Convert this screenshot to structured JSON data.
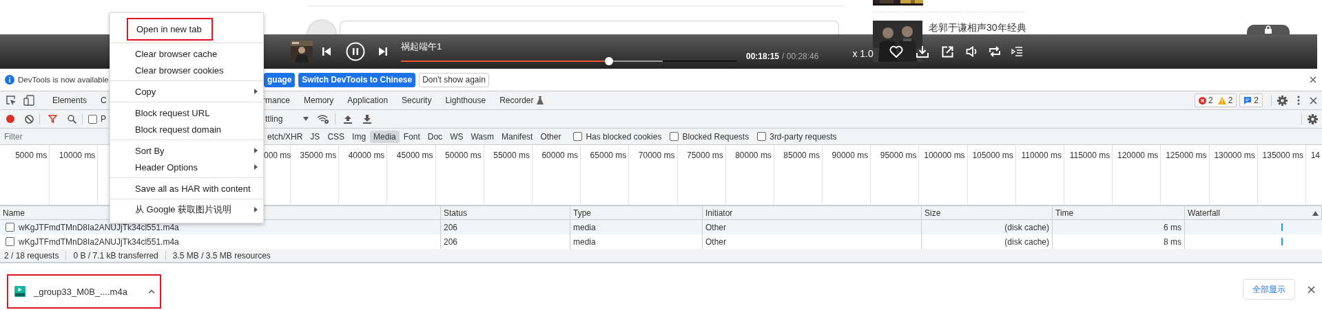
{
  "page": {
    "sidebar_title": "老郭于谦相声30年经典"
  },
  "player": {
    "title": "祸起端午1",
    "elapsed": "00:18:15",
    "total": "/ 00:28:46",
    "speed": "x 1.0",
    "playing": true,
    "progress": {
      "level": 0.62
    },
    "buffer": {
      "level": 0.78
    }
  },
  "infobar": {
    "message": "DevTools is now available",
    "buttons": [
      {
        "label": "guage",
        "kind": "primary"
      },
      {
        "label": "Switch DevTools to Chinese",
        "kind": "primary"
      },
      {
        "label": "Don't show again",
        "kind": "plain"
      }
    ]
  },
  "tabs": {
    "before_menu": [
      {
        "label": "Elements",
        "selected": false
      },
      {
        "label": "C",
        "selected": false
      }
    ],
    "after_menu": [
      {
        "label": "rmance",
        "selected": false
      },
      {
        "label": "Memory",
        "selected": false
      },
      {
        "label": "Application",
        "selected": false
      },
      {
        "label": "Security",
        "selected": false
      },
      {
        "label": "Lighthouse",
        "selected": false
      },
      {
        "label": "Recorder",
        "selected": false
      }
    ]
  },
  "issues": {
    "errors": "2",
    "warnings": "2",
    "messages": "2"
  },
  "toolbar": {
    "recording": true,
    "preserve_label": "P",
    "preserve_checked": false,
    "throttling": "ttling"
  },
  "filter": {
    "placeholder": "Filter",
    "types": [
      {
        "label": "etch/XHR",
        "selected": false
      },
      {
        "label": "JS",
        "selected": false
      },
      {
        "label": "CSS",
        "selected": false
      },
      {
        "label": "Img",
        "selected": false
      },
      {
        "label": "Media",
        "selected": true
      },
      {
        "label": "Font",
        "selected": false
      },
      {
        "label": "Doc",
        "selected": false
      },
      {
        "label": "WS",
        "selected": false
      },
      {
        "label": "Wasm",
        "selected": false
      },
      {
        "label": "Manifest",
        "selected": false
      },
      {
        "label": "Other",
        "selected": false
      }
    ],
    "checkboxes": [
      {
        "label": "Has blocked cookies",
        "checked": false
      },
      {
        "label": "Blocked Requests",
        "checked": false
      },
      {
        "label": "3rd-party requests",
        "checked": false
      }
    ]
  },
  "timeline": {
    "before_menu": [
      "5000 ms",
      "10000 ms"
    ],
    "after_menu": [
      "000 ms",
      "35000 ms",
      "40000 ms",
      "45000 ms",
      "50000 ms",
      "55000 ms",
      "60000 ms",
      "65000 ms",
      "70000 ms",
      "75000 ms",
      "80000 ms",
      "85000 ms",
      "90000 ms",
      "95000 ms",
      "100000 ms",
      "105000 ms",
      "110000 ms",
      "115000 ms",
      "120000 ms",
      "125000 ms",
      "130000 ms",
      "135000 ms",
      "14"
    ]
  },
  "table": {
    "columns": [
      {
        "label": "Name",
        "sorted": false
      },
      {
        "label": "Status",
        "sorted": false
      },
      {
        "label": "Type",
        "sorted": false
      },
      {
        "label": "Initiator",
        "sorted": false
      },
      {
        "label": "Size",
        "sorted": false
      },
      {
        "label": "Time",
        "sorted": false
      },
      {
        "label": "Waterfall",
        "sorted": true
      }
    ],
    "rows": [
      {
        "checked": false,
        "cells": [
          "wKgJTFmdTMnD8Ia2ANUJjTk34cl551.m4a",
          "206",
          "media",
          "Other",
          "(disk cache)",
          "6 ms"
        ]
      },
      {
        "checked": false,
        "cells": [
          "wKgJTFmdTMnD8Ia2ANUJjTk34cl551.m4a",
          "206",
          "media",
          "Other",
          "(disk cache)",
          "8 ms"
        ]
      }
    ]
  },
  "status_bar": [
    "2 / 18 requests",
    "0 B / 7.1 kB transferred",
    "3.5 MB / 3.5 MB resources"
  ],
  "context_menu": [
    [
      {
        "label": "Open in new tab",
        "submenu": false,
        "highlighted": true
      }
    ],
    [
      {
        "label": "Clear browser cache",
        "submenu": false,
        "highlighted": false
      },
      {
        "label": "Clear browser cookies",
        "submenu": false,
        "highlighted": false
      }
    ],
    [
      {
        "label": "Copy",
        "submenu": true,
        "highlighted": false
      }
    ],
    [
      {
        "label": "Block request URL",
        "submenu": false,
        "highlighted": false
      },
      {
        "label": "Block request domain",
        "submenu": false,
        "highlighted": false
      }
    ],
    [
      {
        "label": "Sort By",
        "submenu": true,
        "highlighted": false
      },
      {
        "label": "Header Options",
        "submenu": true,
        "highlighted": false
      }
    ],
    [
      {
        "label": "Save all as HAR with content",
        "submenu": false,
        "highlighted": false
      }
    ],
    [
      {
        "label": "从 Google 获取图片说明",
        "submenu": true,
        "highlighted": false
      }
    ]
  ],
  "downloads": {
    "items": [
      {
        "file": "_group33_M0B_....m4a",
        "highlighted": true
      }
    ],
    "show_all": "全部显示"
  }
}
